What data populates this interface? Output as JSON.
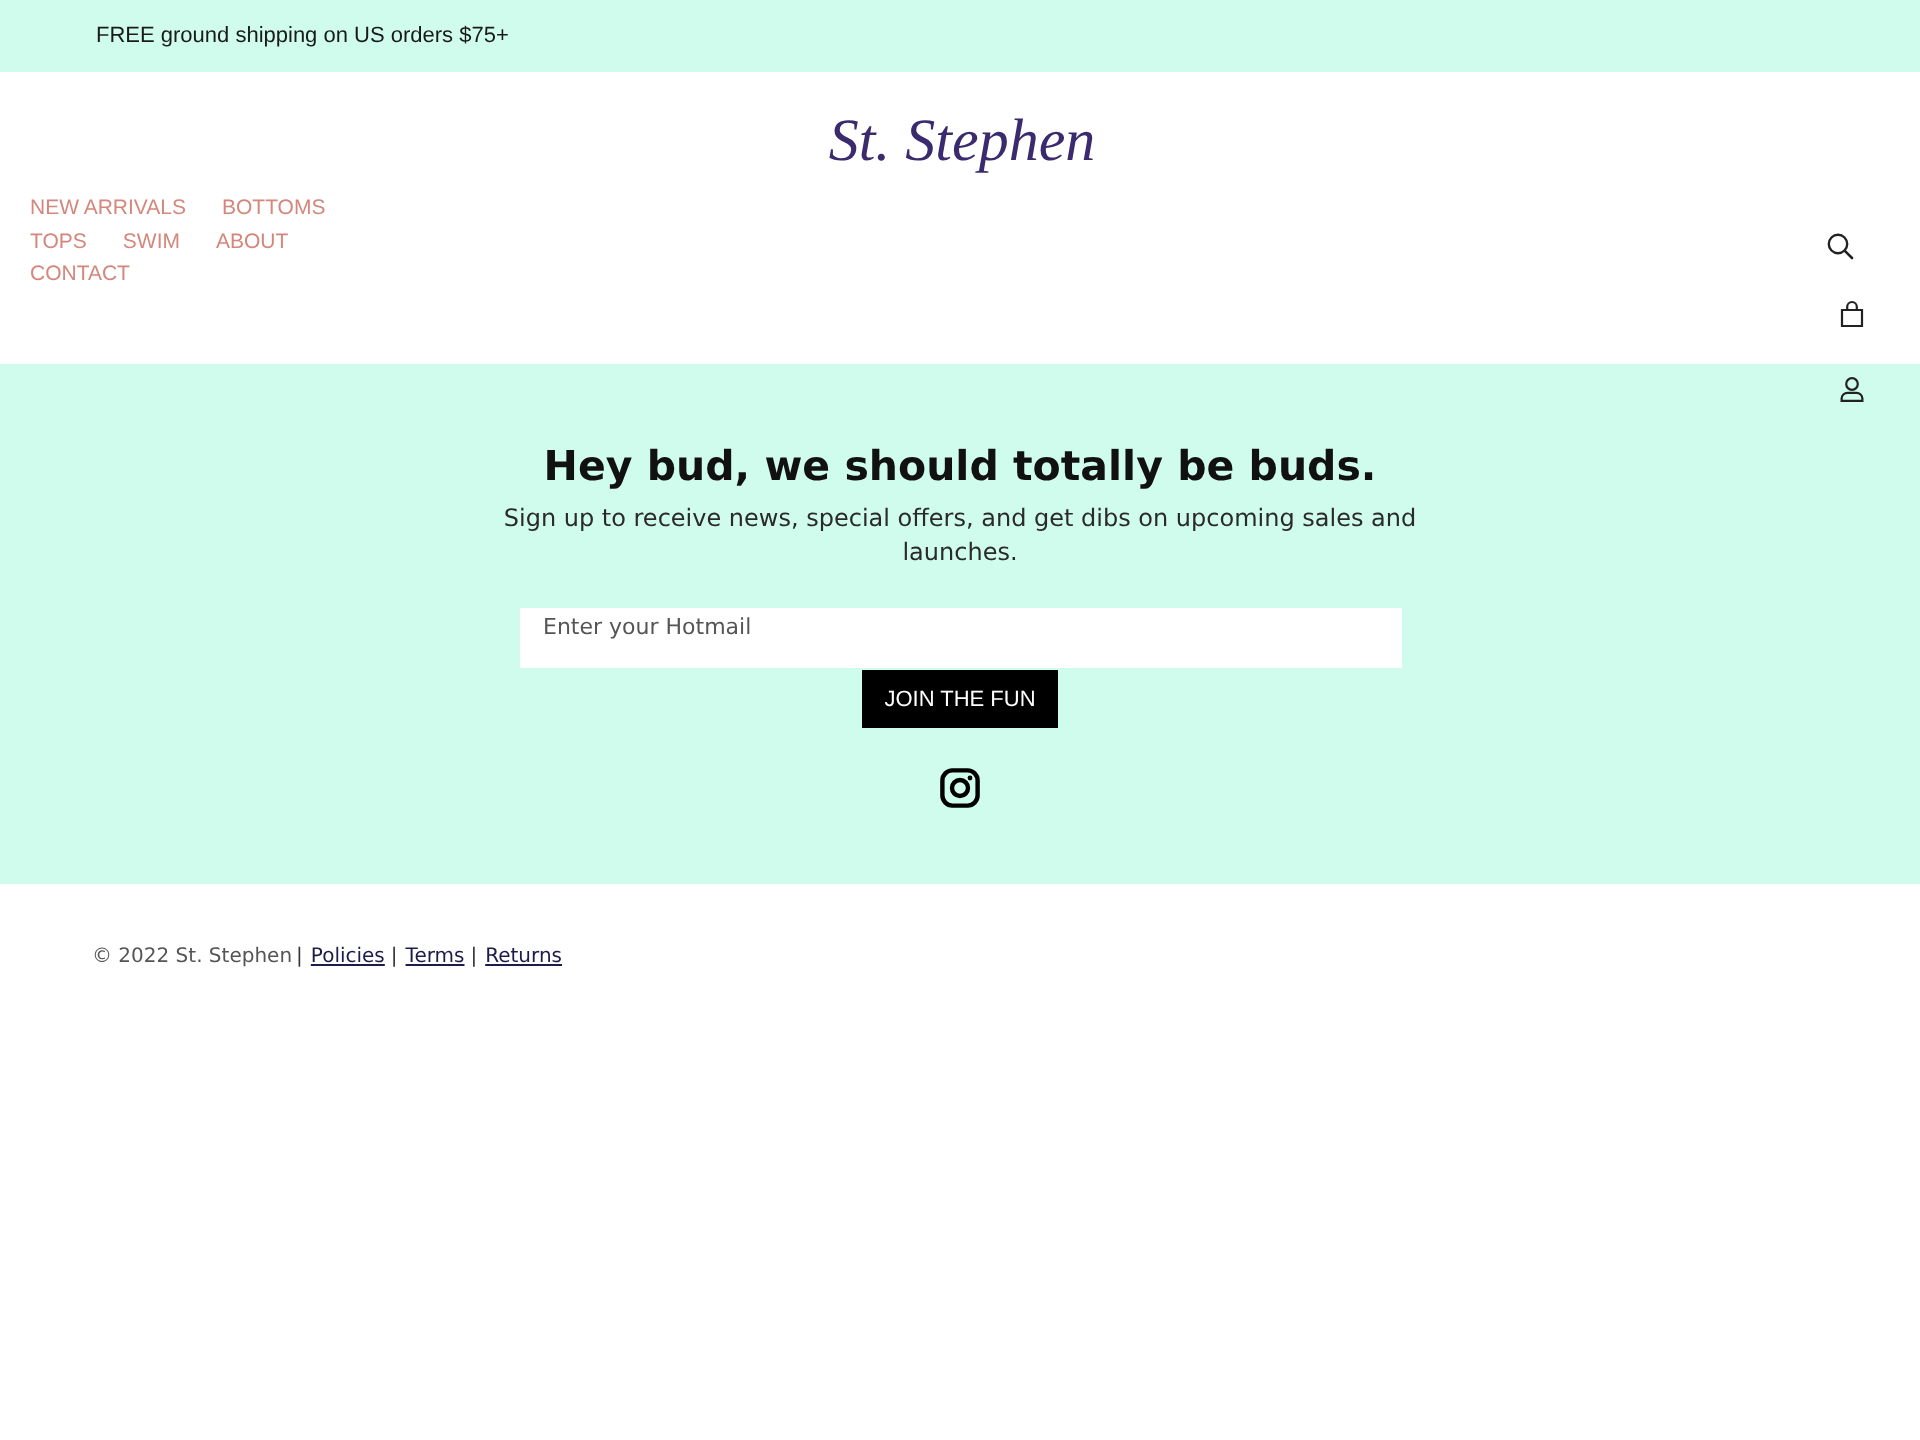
{
  "announcement": {
    "text": "FREE ground shipping on US orders $75+"
  },
  "header": {
    "logo": "St. Stephen",
    "nav": [
      "NEW ARRIVALS",
      "BOTTOMS",
      "TOPS",
      "SWIM",
      "ABOUT",
      "CONTACT"
    ]
  },
  "newsletter": {
    "heading": "Hey bud, we should totally be buds.",
    "text": "Sign up to receive news, special offers, and get dibs on upcoming sales and launches.",
    "email_field": {
      "placeholder": "Enter your Hotmail"
    },
    "button": "JOIN THE FUN"
  },
  "footer": {
    "items": [
      {
        "kind": "text",
        "text": "© 2022 St. Stephen"
      },
      {
        "kind": "separator",
        "text": "|"
      },
      {
        "kind": "link",
        "text": "Policies"
      },
      {
        "kind": "separator",
        "text": "|"
      },
      {
        "kind": "link",
        "text": "Terms"
      },
      {
        "kind": "separator",
        "text": "|"
      },
      {
        "kind": "link",
        "text": "Returns"
      }
    ]
  }
}
